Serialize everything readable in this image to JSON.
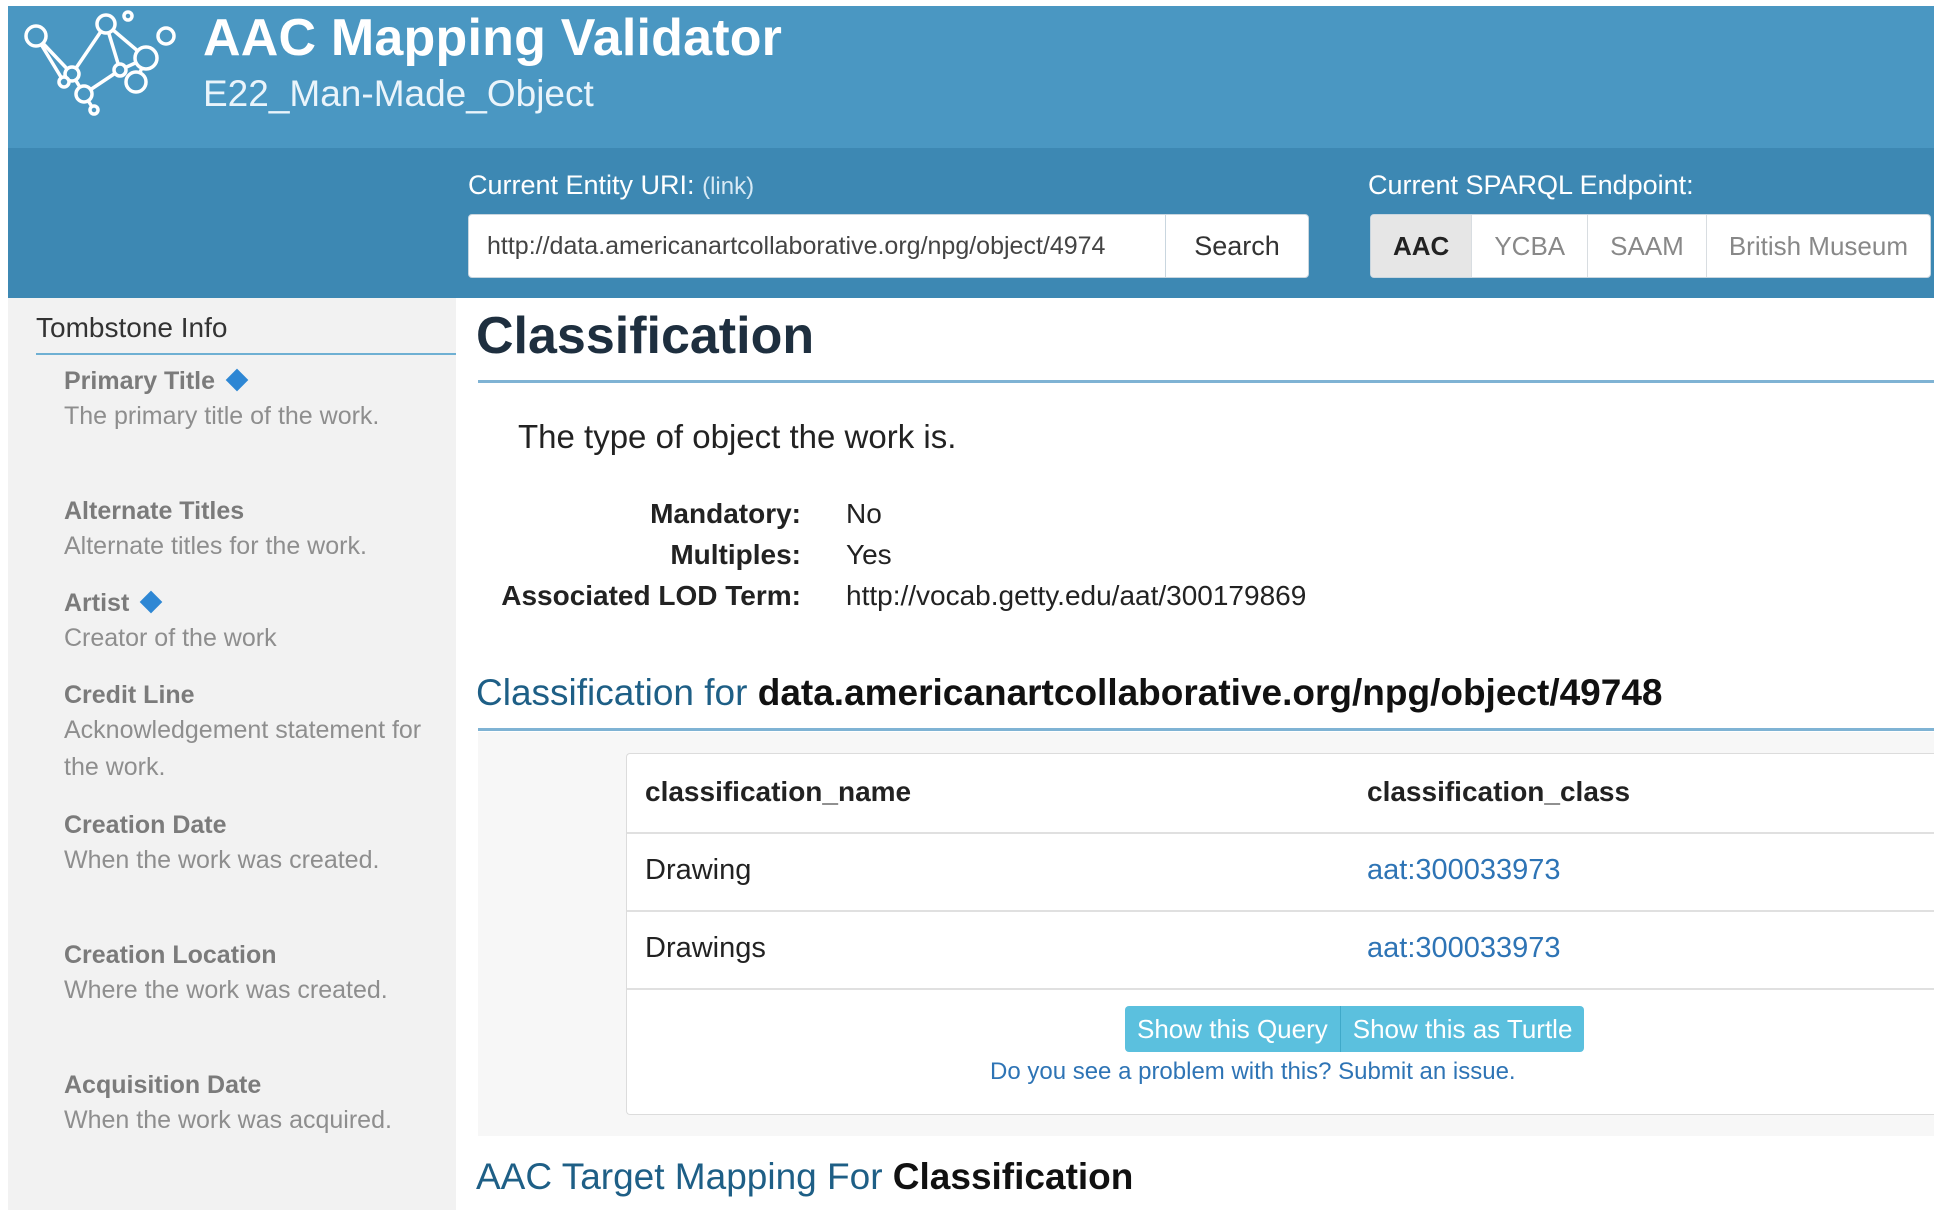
{
  "header": {
    "title": "AAC Mapping Validator",
    "subtitle": "E22_Man-Made_Object"
  },
  "toolbar": {
    "uri_label": "Current Entity URI:",
    "uri_link": "(link)",
    "uri_value": "http://data.americanartcollaborative.org/npg/object/4974",
    "search_label": "Search",
    "endpoint_label": "Current SPARQL Endpoint:",
    "endpoints": [
      "AAC",
      "YCBA",
      "SAAM",
      "British Museum"
    ],
    "active_endpoint": "AAC"
  },
  "sidebar": {
    "title": "Tombstone Info",
    "items": [
      {
        "name": "Primary Title",
        "desc": "The primary title of the work.",
        "mandatory": true
      },
      {
        "name": "Alternate Titles",
        "desc": "Alternate titles for the work.",
        "mandatory": false
      },
      {
        "name": "Artist",
        "desc": "Creator of the work",
        "mandatory": true
      },
      {
        "name": "Credit Line",
        "desc": "Acknowledgement statement for the work.",
        "mandatory": false
      },
      {
        "name": "Creation Date",
        "desc": "When the work was created.",
        "mandatory": false
      },
      {
        "name": "Creation Location",
        "desc": "Where the work was created.",
        "mandatory": false
      },
      {
        "name": "Acquisition Date",
        "desc": "When the work was acquired.",
        "mandatory": false
      }
    ]
  },
  "main": {
    "title": "Classification",
    "description": "The type of object the work is.",
    "props": [
      {
        "key": "Mandatory:",
        "value": "No"
      },
      {
        "key": "Multiples:",
        "value": "Yes"
      },
      {
        "key": "Associated LOD Term:",
        "value": "http://vocab.getty.edu/aat/300179869"
      }
    ],
    "results_heading_prefix": "Classification for ",
    "results_heading_entity": "data.americanartcollaborative.org/npg/object/49748",
    "table": {
      "columns": [
        "classification_name",
        "classification_class"
      ],
      "rows": [
        [
          "Drawing",
          "aat:300033973"
        ],
        [
          "Drawings",
          "aat:300033973"
        ]
      ]
    },
    "show_query_label": "Show this Query",
    "show_turtle_label": "Show this as Turtle",
    "issue_link": "Do you see a problem with this? Submit an issue.",
    "target_heading_prefix": "AAC Target Mapping For ",
    "target_heading_bold": "Classification"
  },
  "colors": {
    "header": "#4a97c2",
    "toolbar": "#3d88b3",
    "info_button": "#5bc0de",
    "link": "#2e74b5"
  }
}
